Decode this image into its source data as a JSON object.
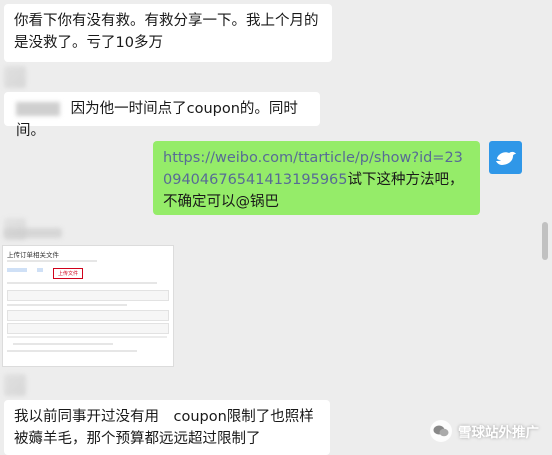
{
  "messages": {
    "m1": "你看下你有没有救。有救分享一下。我上个月的是没救了。亏了10多万",
    "m2": "因为他一时间点了coupon的。同时间。",
    "m3_link": "https://weibo.com/ttarticle/p/show?id=2309404676541413195965",
    "m3_text": "试下这种方法吧，不确定可以@锅巴",
    "m5": "我以前同事开过没有用　coupon限制了也照样被薅羊毛，那个预算都远远超过限制了"
  },
  "thumbnail": {
    "title": "上传订单相关文件",
    "tab_active": "上传文件"
  },
  "watermark": {
    "text": "雪球站外推广"
  }
}
